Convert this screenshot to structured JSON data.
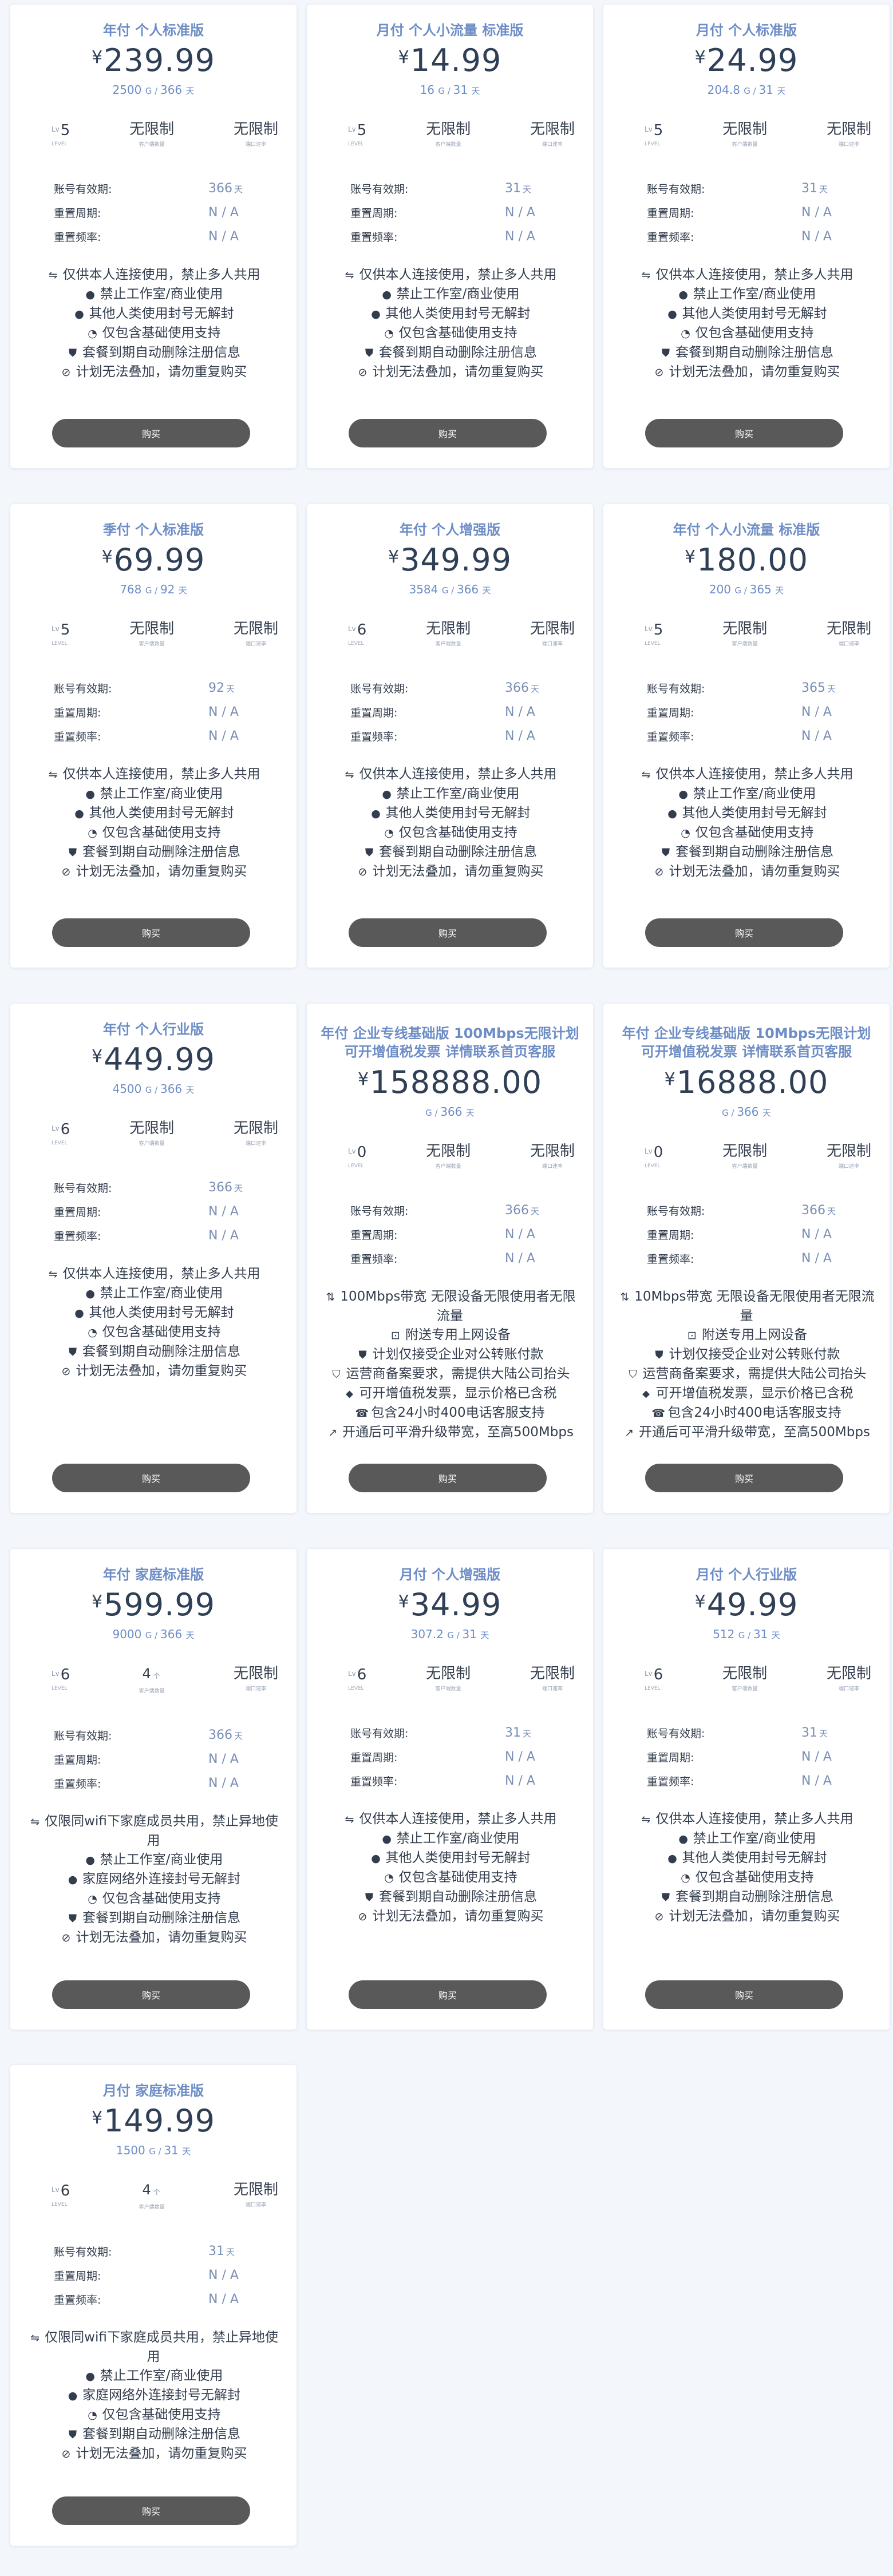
{
  "buy_label": "购买",
  "labels": {
    "validity": "账号有效期:",
    "reset_period": "重置周期:",
    "reset_freq": "重置频率:",
    "lv_prefix": "Lv",
    "lv_caption": "LEVEL",
    "devices_caption": "客户端数量",
    "ports_caption": "端口速率",
    "day_unit": "天",
    "count_unit": "个",
    "gb_unit": "G"
  },
  "icon_glyphs": {
    "share-icon": "⇋",
    "ban-icon": "●",
    "alert-icon": "●",
    "basic-icon": "◔",
    "shield-icon": "⛊",
    "stack-icon": "⊘",
    "bandwidth-icon": "⇅",
    "device-icon": "⊡",
    "invoice-icon": "⛉",
    "tag-icon": "⬥",
    "phone-icon": "☎",
    "expand-icon": "↗"
  },
  "plans": [
    {
      "title": "年付 个人标准版",
      "price": "239.99",
      "traffic": "2500",
      "days_text": "366",
      "level": "5",
      "devices": "无限制",
      "ports": "无限制",
      "validity": "366",
      "reset_period": "N / A",
      "reset_freq": "N / A",
      "features": [
        {
          "icon": "share-icon",
          "text": "仅供本人连接使用，禁止多人共用"
        },
        {
          "icon": "ban-icon",
          "text": "禁止工作室/商业使用"
        },
        {
          "icon": "alert-icon",
          "text": "其他人类使用封号无解封"
        },
        {
          "icon": "basic-icon",
          "text": "仅包含基础使用支持"
        },
        {
          "icon": "shield-icon",
          "text": "套餐到期自动删除注册信息"
        },
        {
          "icon": "stack-icon",
          "text": "计划无法叠加，请勿重复购买"
        }
      ]
    },
    {
      "title": "月付 个人小流量 标准版",
      "price": "14.99",
      "traffic": "16",
      "days_text": "31",
      "level": "5",
      "devices": "无限制",
      "ports": "无限制",
      "validity": "31",
      "reset_period": "N / A",
      "reset_freq": "N / A",
      "features": [
        {
          "icon": "share-icon",
          "text": "仅供本人连接使用，禁止多人共用"
        },
        {
          "icon": "ban-icon",
          "text": "禁止工作室/商业使用"
        },
        {
          "icon": "alert-icon",
          "text": "其他人类使用封号无解封"
        },
        {
          "icon": "basic-icon",
          "text": "仅包含基础使用支持"
        },
        {
          "icon": "shield-icon",
          "text": "套餐到期自动删除注册信息"
        },
        {
          "icon": "stack-icon",
          "text": "计划无法叠加，请勿重复购买"
        }
      ]
    },
    {
      "title": "月付 个人标准版",
      "price": "24.99",
      "traffic": "204.8",
      "days_text": "31",
      "level": "5",
      "devices": "无限制",
      "ports": "无限制",
      "validity": "31",
      "reset_period": "N / A",
      "reset_freq": "N / A",
      "features": [
        {
          "icon": "share-icon",
          "text": "仅供本人连接使用，禁止多人共用"
        },
        {
          "icon": "ban-icon",
          "text": "禁止工作室/商业使用"
        },
        {
          "icon": "alert-icon",
          "text": "其他人类使用封号无解封"
        },
        {
          "icon": "basic-icon",
          "text": "仅包含基础使用支持"
        },
        {
          "icon": "shield-icon",
          "text": "套餐到期自动删除注册信息"
        },
        {
          "icon": "stack-icon",
          "text": "计划无法叠加，请勿重复购买"
        }
      ]
    },
    {
      "title": "季付 个人标准版",
      "price": "69.99",
      "traffic": "768",
      "days_text": "92",
      "level": "5",
      "devices": "无限制",
      "ports": "无限制",
      "validity": "92",
      "reset_period": "N / A",
      "reset_freq": "N / A",
      "features": [
        {
          "icon": "share-icon",
          "text": "仅供本人连接使用，禁止多人共用"
        },
        {
          "icon": "ban-icon",
          "text": "禁止工作室/商业使用"
        },
        {
          "icon": "alert-icon",
          "text": "其他人类使用封号无解封"
        },
        {
          "icon": "basic-icon",
          "text": "仅包含基础使用支持"
        },
        {
          "icon": "shield-icon",
          "text": "套餐到期自动删除注册信息"
        },
        {
          "icon": "stack-icon",
          "text": "计划无法叠加，请勿重复购买"
        }
      ]
    },
    {
      "title": "年付 个人增强版",
      "price": "349.99",
      "traffic": "3584",
      "days_text": "366",
      "level": "6",
      "devices": "无限制",
      "ports": "无限制",
      "validity": "366",
      "reset_period": "N / A",
      "reset_freq": "N / A",
      "features": [
        {
          "icon": "share-icon",
          "text": "仅供本人连接使用，禁止多人共用"
        },
        {
          "icon": "ban-icon",
          "text": "禁止工作室/商业使用"
        },
        {
          "icon": "alert-icon",
          "text": "其他人类使用封号无解封"
        },
        {
          "icon": "basic-icon",
          "text": "仅包含基础使用支持"
        },
        {
          "icon": "shield-icon",
          "text": "套餐到期自动删除注册信息"
        },
        {
          "icon": "stack-icon",
          "text": "计划无法叠加，请勿重复购买"
        }
      ]
    },
    {
      "title": "年付 个人小流量 标准版",
      "price": "180.00",
      "traffic": "200",
      "days_text": "365",
      "level": "5",
      "devices": "无限制",
      "ports": "无限制",
      "validity": "365",
      "reset_period": "N / A",
      "reset_freq": "N / A",
      "features": [
        {
          "icon": "share-icon",
          "text": "仅供本人连接使用，禁止多人共用"
        },
        {
          "icon": "ban-icon",
          "text": "禁止工作室/商业使用"
        },
        {
          "icon": "alert-icon",
          "text": "其他人类使用封号无解封"
        },
        {
          "icon": "basic-icon",
          "text": "仅包含基础使用支持"
        },
        {
          "icon": "shield-icon",
          "text": "套餐到期自动删除注册信息"
        },
        {
          "icon": "stack-icon",
          "text": "计划无法叠加，请勿重复购买"
        }
      ]
    },
    {
      "title": "年付 个人行业版",
      "price": "449.99",
      "traffic": "4500",
      "days_text": "366",
      "level": "6",
      "devices": "无限制",
      "ports": "无限制",
      "validity": "366",
      "reset_period": "N / A",
      "reset_freq": "N / A",
      "features": [
        {
          "icon": "share-icon",
          "text": "仅供本人连接使用，禁止多人共用"
        },
        {
          "icon": "ban-icon",
          "text": "禁止工作室/商业使用"
        },
        {
          "icon": "alert-icon",
          "text": "其他人类使用封号无解封"
        },
        {
          "icon": "basic-icon",
          "text": "仅包含基础使用支持"
        },
        {
          "icon": "shield-icon",
          "text": "套餐到期自动删除注册信息"
        },
        {
          "icon": "stack-icon",
          "text": "计划无法叠加，请勿重复购买"
        }
      ]
    },
    {
      "title": "年付 企业专线基础版 100Mbps无限计划 可开增值税发票 详情联系首页客服",
      "price": "158888.00",
      "traffic": "",
      "days_text": "366",
      "level": "0",
      "devices": "无限制",
      "ports": "无限制",
      "validity": "366",
      "reset_period": "N / A",
      "reset_freq": "N / A",
      "features": [
        {
          "icon": "bandwidth-icon",
          "text": "100Mbps带宽 无限设备无限使用者无限流量"
        },
        {
          "icon": "device-icon",
          "text": "附送专用上网设备"
        },
        {
          "icon": "shield-icon",
          "text": "计划仅接受企业对公转账付款"
        },
        {
          "icon": "invoice-icon",
          "text": "运营商备案要求，需提供大陆公司抬头"
        },
        {
          "icon": "tag-icon",
          "text": "可开增值税发票，显示价格已含税"
        },
        {
          "icon": "phone-icon",
          "text": "包含24小时400电话客服支持"
        },
        {
          "icon": "expand-icon",
          "text": "开通后可平滑升级带宽，至高500Mbps"
        }
      ]
    },
    {
      "title": "年付 企业专线基础版 10Mbps无限计划 可开增值税发票 详情联系首页客服",
      "price": "16888.00",
      "traffic": "",
      "days_text": "366",
      "level": "0",
      "devices": "无限制",
      "ports": "无限制",
      "validity": "366",
      "reset_period": "N / A",
      "reset_freq": "N / A",
      "features": [
        {
          "icon": "bandwidth-icon",
          "text": "10Mbps带宽 无限设备无限使用者无限流量"
        },
        {
          "icon": "device-icon",
          "text": "附送专用上网设备"
        },
        {
          "icon": "shield-icon",
          "text": "计划仅接受企业对公转账付款"
        },
        {
          "icon": "invoice-icon",
          "text": "运营商备案要求，需提供大陆公司抬头"
        },
        {
          "icon": "tag-icon",
          "text": "可开增值税发票，显示价格已含税"
        },
        {
          "icon": "phone-icon",
          "text": "包含24小时400电话客服支持"
        },
        {
          "icon": "expand-icon",
          "text": "开通后可平滑升级带宽，至高500Mbps"
        }
      ]
    },
    {
      "title": "年付 家庭标准版",
      "price": "599.99",
      "traffic": "9000",
      "days_text": "366",
      "level": "6",
      "devices": "4",
      "ports": "无限制",
      "validity": "366",
      "reset_period": "N / A",
      "reset_freq": "N / A",
      "features": [
        {
          "icon": "share-icon",
          "text": "仅限同wifi下家庭成员共用，禁止异地使用"
        },
        {
          "icon": "ban-icon",
          "text": "禁止工作室/商业使用"
        },
        {
          "icon": "alert-icon",
          "text": "家庭网络外连接封号无解封"
        },
        {
          "icon": "basic-icon",
          "text": "仅包含基础使用支持"
        },
        {
          "icon": "shield-icon",
          "text": "套餐到期自动删除注册信息"
        },
        {
          "icon": "stack-icon",
          "text": "计划无法叠加，请勿重复购买"
        }
      ]
    },
    {
      "title": "月付 个人增强版",
      "price": "34.99",
      "traffic": "307.2",
      "days_text": "31",
      "level": "6",
      "devices": "无限制",
      "ports": "无限制",
      "validity": "31",
      "reset_period": "N / A",
      "reset_freq": "N / A",
      "features": [
        {
          "icon": "share-icon",
          "text": "仅供本人连接使用，禁止多人共用"
        },
        {
          "icon": "ban-icon",
          "text": "禁止工作室/商业使用"
        },
        {
          "icon": "alert-icon",
          "text": "其他人类使用封号无解封"
        },
        {
          "icon": "basic-icon",
          "text": "仅包含基础使用支持"
        },
        {
          "icon": "shield-icon",
          "text": "套餐到期自动删除注册信息"
        },
        {
          "icon": "stack-icon",
          "text": "计划无法叠加，请勿重复购买"
        }
      ]
    },
    {
      "title": "月付 个人行业版",
      "price": "49.99",
      "traffic": "512",
      "days_text": "31",
      "level": "6",
      "devices": "无限制",
      "ports": "无限制",
      "validity": "31",
      "reset_period": "N / A",
      "reset_freq": "N / A",
      "features": [
        {
          "icon": "share-icon",
          "text": "仅供本人连接使用，禁止多人共用"
        },
        {
          "icon": "ban-icon",
          "text": "禁止工作室/商业使用"
        },
        {
          "icon": "alert-icon",
          "text": "其他人类使用封号无解封"
        },
        {
          "icon": "basic-icon",
          "text": "仅包含基础使用支持"
        },
        {
          "icon": "shield-icon",
          "text": "套餐到期自动删除注册信息"
        },
        {
          "icon": "stack-icon",
          "text": "计划无法叠加，请勿重复购买"
        }
      ]
    },
    {
      "title": "月付 家庭标准版",
      "price": "149.99",
      "traffic": "1500",
      "days_text": "31",
      "level": "6",
      "devices": "4",
      "ports": "无限制",
      "validity": "31",
      "reset_period": "N / A",
      "reset_freq": "N / A",
      "features": [
        {
          "icon": "share-icon",
          "text": "仅限同wifi下家庭成员共用，禁止异地使用"
        },
        {
          "icon": "ban-icon",
          "text": "禁止工作室/商业使用"
        },
        {
          "icon": "alert-icon",
          "text": "家庭网络外连接封号无解封"
        },
        {
          "icon": "basic-icon",
          "text": "仅包含基础使用支持"
        },
        {
          "icon": "shield-icon",
          "text": "套餐到期自动删除注册信息"
        },
        {
          "icon": "stack-icon",
          "text": "计划无法叠加，请勿重复购买"
        }
      ]
    }
  ]
}
